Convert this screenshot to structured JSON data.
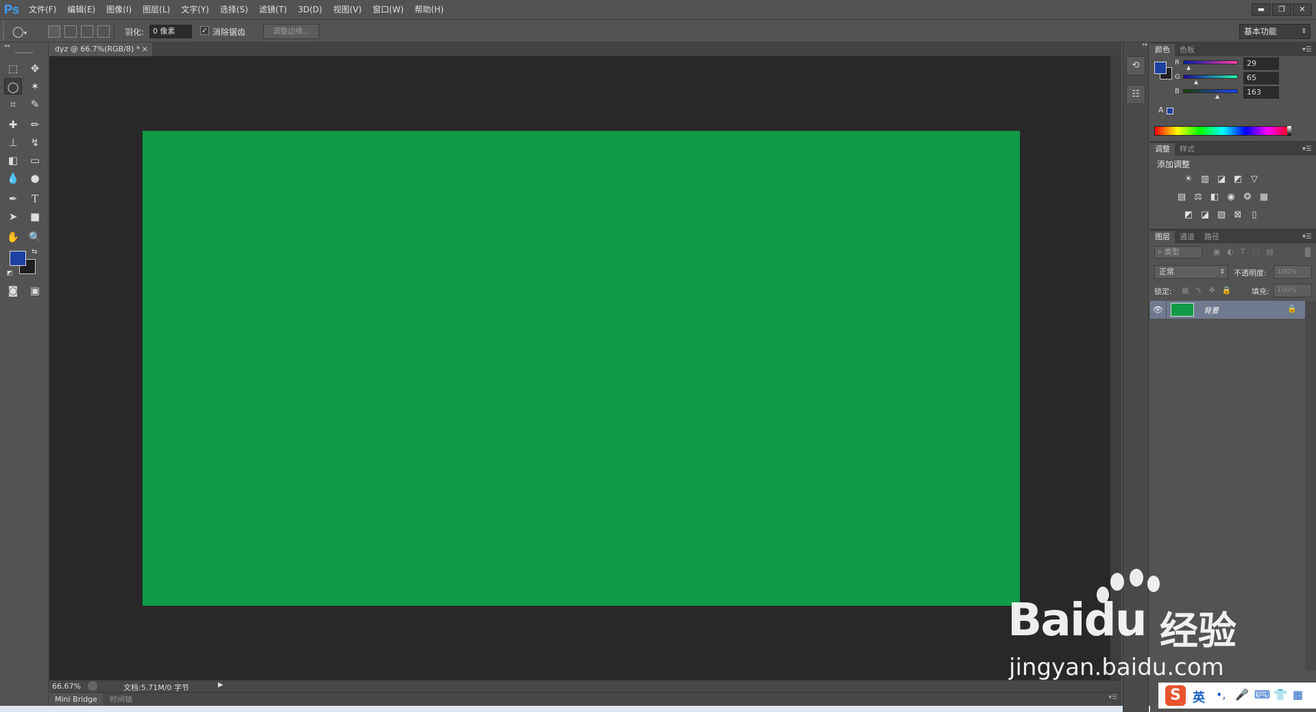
{
  "app": {
    "logo": "Ps"
  },
  "menu": [
    "文件(F)",
    "编辑(E)",
    "图像(I)",
    "图层(L)",
    "文字(Y)",
    "选择(S)",
    "滤镜(T)",
    "3D(D)",
    "视图(V)",
    "窗口(W)",
    "帮助(H)"
  ],
  "window_controls": {
    "minimize": "▬",
    "restore": "❐",
    "close": "✕"
  },
  "options": {
    "feather_label": "羽化:",
    "feather_value": "0 像素",
    "antialias_label": "消除锯齿",
    "antialias_checked": true,
    "refine_edge_label": "调整边缘...",
    "workspace_label": "基本功能"
  },
  "document": {
    "tab_title": "dyz @ 66.7%(RGB/8) *",
    "close": "×",
    "canvas_color": "#109a46",
    "zoom": "66.67%",
    "doc_info": "文档:5.71M/0 字节"
  },
  "bottom_tabs": [
    "Mini Bridge",
    "时间轴"
  ],
  "color_panel": {
    "tabs": [
      "颜色",
      "色板"
    ],
    "foreground": "#1d41a3",
    "background": "#1f1f1f",
    "channels": [
      {
        "label": "R",
        "value": "29",
        "fraction": 0.11
      },
      {
        "label": "G",
        "value": "65",
        "fraction": 0.25
      },
      {
        "label": "B",
        "value": "163",
        "fraction": 0.64
      }
    ]
  },
  "adjustments_panel": {
    "tabs": [
      "调整",
      "样式"
    ],
    "title": "添加调整",
    "row1": [
      "brightness-icon",
      "levels-icon",
      "curves-icon",
      "exposure-icon",
      "vibrance-icon"
    ],
    "row2": [
      "hue-saturation-icon",
      "color-balance-icon",
      "black-white-icon",
      "photo-filter-icon",
      "channel-mixer-icon",
      "color-lookup-icon"
    ],
    "row3": [
      "invert-icon",
      "posterize-icon",
      "threshold-icon",
      "selective-color-icon",
      "gradient-map-icon"
    ]
  },
  "layers_panel": {
    "tabs": [
      "图层",
      "通道",
      "路径"
    ],
    "filter_label": "类型",
    "blend_mode": "正常",
    "opacity_label": "不透明度:",
    "opacity_value": "100%",
    "lock_label": "锁定:",
    "fill_label": "填充:",
    "fill_value": "100%",
    "layers": [
      {
        "name": "背景",
        "thumb_color": "#109a46",
        "visible": true,
        "locked": true
      }
    ]
  },
  "watermark": {
    "brand": "Baidu",
    "brand_cn": "经验",
    "url": "jingyan.baidu.com"
  },
  "ime": {
    "logo": "S",
    "mode": "英"
  }
}
